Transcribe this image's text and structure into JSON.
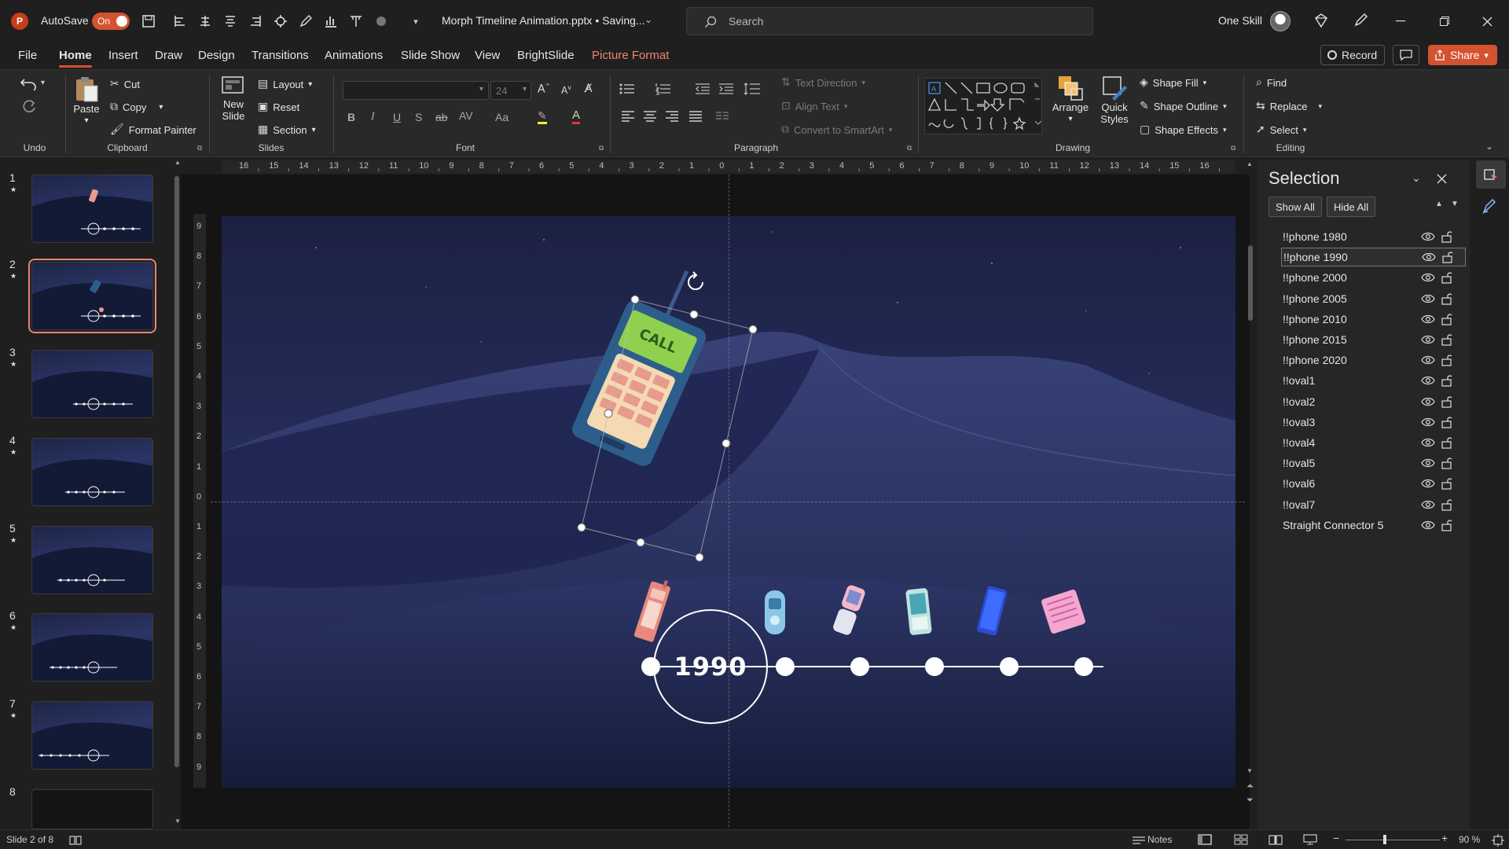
{
  "titlebar": {
    "autosave_label": "AutoSave",
    "autosave_state": "On",
    "doc_title": "Morph Timeline Animation.pptx • Saving...",
    "search_placeholder": "Search",
    "user_name": "One Skill"
  },
  "menu": {
    "tabs": [
      "File",
      "Home",
      "Insert",
      "Draw",
      "Design",
      "Transitions",
      "Animations",
      "Slide Show",
      "View",
      "BrightSlide",
      "Picture Format"
    ],
    "active": "Home",
    "record_label": "Record",
    "share_label": "Share"
  },
  "ribbon": {
    "undo_group": "Undo",
    "clipboard": {
      "paste": "Paste",
      "cut": "Cut",
      "copy": "Copy",
      "format_painter": "Format Painter",
      "group": "Clipboard"
    },
    "slides": {
      "new_slide": "New Slide",
      "layout": "Layout",
      "reset": "Reset",
      "section": "Section",
      "group": "Slides"
    },
    "font": {
      "size": "24",
      "group": "Font"
    },
    "paragraph": {
      "text_direction": "Text Direction",
      "align_text": "Align Text",
      "convert_smartart": "Convert to SmartArt",
      "group": "Paragraph"
    },
    "drawing": {
      "arrange": "Arrange",
      "quick_styles": "Quick Styles",
      "shape_fill": "Shape Fill",
      "shape_outline": "Shape Outline",
      "shape_effects": "Shape Effects",
      "group": "Drawing"
    },
    "editing": {
      "find": "Find",
      "replace": "Replace",
      "select": "Select",
      "group": "Editing"
    }
  },
  "thumbnails": [
    {
      "num": "1",
      "star": "★",
      "year_pos": "left"
    },
    {
      "num": "2",
      "star": "★",
      "year_pos": "left",
      "selected": true
    },
    {
      "num": "3",
      "star": "★"
    },
    {
      "num": "4",
      "star": "★"
    },
    {
      "num": "5",
      "star": "★"
    },
    {
      "num": "6",
      "star": "★"
    },
    {
      "num": "7",
      "star": "★"
    },
    {
      "num": "8",
      "star": ""
    }
  ],
  "rulers": {
    "h_ticks": [
      "16",
      "15",
      "14",
      "13",
      "12",
      "11",
      "10",
      "9",
      "8",
      "7",
      "6",
      "5",
      "4",
      "3",
      "2",
      "1",
      "0",
      "1",
      "2",
      "3",
      "4",
      "5",
      "6",
      "7",
      "8",
      "9",
      "10",
      "11",
      "12",
      "13",
      "14",
      "15",
      "16"
    ],
    "v_ticks": [
      "9",
      "8",
      "7",
      "6",
      "5",
      "4",
      "3",
      "2",
      "1",
      "0",
      "1",
      "2",
      "3",
      "4",
      "5",
      "6",
      "7",
      "8",
      "9"
    ]
  },
  "slide": {
    "year_label": "1990",
    "phone_screen_text": "CALL"
  },
  "selection_pane": {
    "title": "Selection",
    "show_all": "Show All",
    "hide_all": "Hide All",
    "items": [
      "!!phone 1980",
      "!!phone 1990",
      "!!phone 2000",
      "!!phone 2005",
      "!!phone 2010",
      "!!phone 2015",
      "!!phone 2020",
      "!!oval1",
      "!!oval2",
      "!!oval3",
      "!!oval4",
      "!!oval5",
      "!!oval6",
      "!!oval7",
      "Straight Connector 5"
    ],
    "selected_index": 1
  },
  "statusbar": {
    "slide_info": "Slide 2 of 8",
    "notes": "Notes",
    "zoom": "90 %"
  },
  "colors": {
    "accent": "#d35230",
    "contextual_tab": "#f0866c",
    "toggle_on": "#d35230"
  }
}
